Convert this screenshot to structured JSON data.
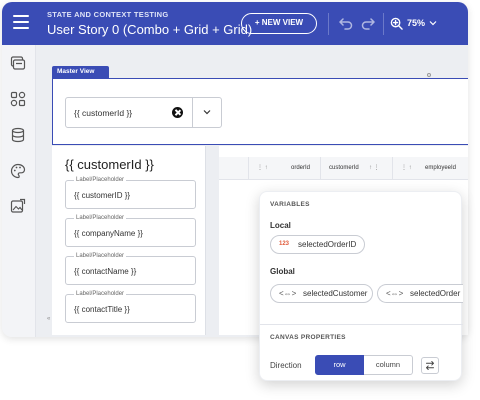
{
  "header": {
    "subtitle": "STATE AND CONTEXT TESTING",
    "title": "User Story 0 (Combo + Grid + Grid)",
    "new_view_label": "+ NEW VIEW",
    "zoom_label": "75%"
  },
  "sidebar": {
    "icons": [
      "pages-icon",
      "components-icon",
      "database-icon",
      "palette-icon",
      "image-export-icon"
    ]
  },
  "canvas": {
    "master_tab": "Master View",
    "combo": {
      "value": "{{ customerId }}"
    },
    "form": {
      "title": "{{ customerId }}",
      "fields": [
        {
          "label": "Label/Placeholder",
          "value": "{{ customerID }}"
        },
        {
          "label": "Label/Placeholder",
          "value": "{{ companyName }}"
        },
        {
          "label": "Label/Placeholder",
          "value": "{{ contactName }}"
        },
        {
          "label": "Label/Placeholder",
          "value": "{{ contactTitle }}"
        }
      ]
    },
    "grid": {
      "columns": [
        "orderId",
        "customerId",
        "employeeId"
      ]
    }
  },
  "popover": {
    "variables_heading": "VARIABLES",
    "local_heading": "Local",
    "local_vars": [
      {
        "badge": "123",
        "name": "selectedOrderID"
      }
    ],
    "global_heading": "Global",
    "global_vars": [
      {
        "name": "selectedCustomer"
      },
      {
        "name": "selectedOrder"
      }
    ],
    "canvas_heading": "CANVAS PROPERTIES",
    "direction_label": "Direction",
    "direction_options": [
      "row",
      "column"
    ],
    "direction_selected": "row"
  },
  "colors": {
    "brand": "#3a4cb5",
    "badge": "#e05a3a"
  }
}
